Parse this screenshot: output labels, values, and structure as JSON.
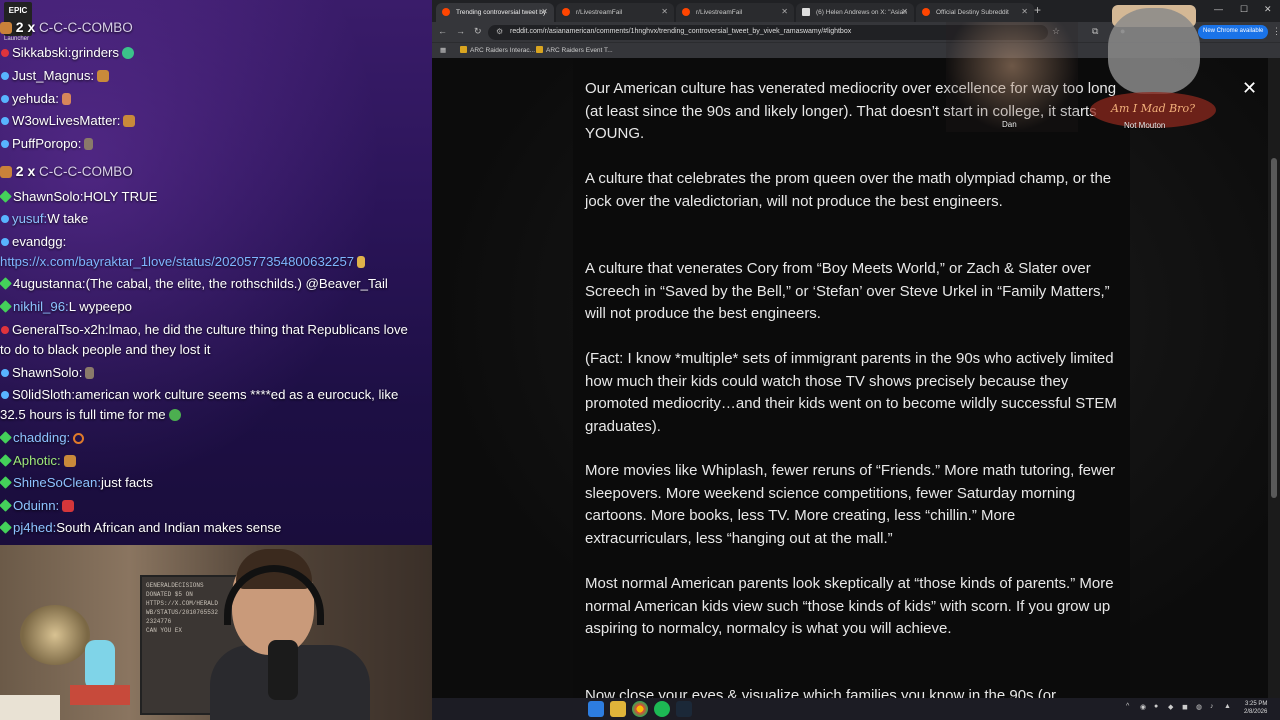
{
  "chat": {
    "launcher_logo": "EPIC",
    "launcher_label": "Launcher",
    "combo_1": {
      "count": "2 x",
      "text": "C-C-C-COMBO"
    },
    "messages_top": [
      {
        "user": "Sikkabski:",
        "text": "grinders"
      },
      {
        "user": "Just_Magnus:",
        "text": ""
      },
      {
        "user": "yehuda:",
        "text": ""
      },
      {
        "user": "W3owLivesMatter:",
        "text": ""
      },
      {
        "user": "PuffPoropo:",
        "text": ""
      }
    ],
    "combo_2": {
      "count": "2 x",
      "text": "C-C-C-COMBO"
    },
    "messages": [
      {
        "user": "ShawnSolo:",
        "text": "HOLY TRUE"
      },
      {
        "user": "yusuf:",
        "text": "W take"
      },
      {
        "user": "evandgg:",
        "text": ""
      },
      {
        "link": "https://x.com/bayraktar_1love/status/2020577354800632257"
      },
      {
        "user": "4ugustanna:",
        "text": "(The cabal, the elite, the rothschilds.) @Beaver_Tail"
      },
      {
        "user": "nikhil_96:",
        "text": "L wypeepo"
      },
      {
        "user": "GeneralTso-x2h:",
        "text": "lmao, he did the culture thing that Republicans love to do to black people and they lost it"
      },
      {
        "user": "ShawnSolo:",
        "text": ""
      },
      {
        "user": "S0lidSloth:",
        "text": "american work culture seems ****ed as a eurocuck, like 32.5 hours is full time for me"
      },
      {
        "user": "chadding:",
        "text": ""
      },
      {
        "user": "Aphotic:",
        "text": ""
      },
      {
        "user": "ShineSoClean:",
        "text": "just facts"
      },
      {
        "user": "Oduinn:",
        "text": ""
      },
      {
        "user": "pj4hed:",
        "text": "South African and Indian makes sense"
      }
    ]
  },
  "webcam": {
    "frame_text": "GENERALDECISIONS\nDONATED $5 ON\nHTTPS://X.COM/HERALD\nWB/STATUS/2010765532\n2324776\nCAN YOU EX"
  },
  "browser": {
    "tabs": [
      {
        "label": "Trending controversial tweet by"
      },
      {
        "label": "r/LivestreamFail"
      },
      {
        "label": "r/LivestreamFail"
      },
      {
        "label": "(6) Helen Andrews on X: \"Asian"
      },
      {
        "label": "Official Destiny Subreddit"
      }
    ],
    "new_tab": "+",
    "url": "reddit.com/r/asianamerican/comments/1hnghvx/trending_controversial_tweet_by_vivek_ramaswamy/#lightbox",
    "update_button": "New Chrome available",
    "bookmarks": [
      {
        "label": "ARC Raiders Interac..."
      },
      {
        "label": "ARC Raiders Event T..."
      }
    ],
    "close": "✕"
  },
  "post": {
    "paragraphs": [
      "Our American culture has venerated mediocrity over excellence for way too long (at least since the 90s and likely longer). That doesn’t start in college, it starts YOUNG.",
      "A culture that celebrates the prom queen over the math olympiad champ, or the jock over the valedictorian, will not produce the best engineers.",
      "A culture that venerates Cory from “Boy Meets World,” or Zach & Slater over Screech in “Saved by the Bell,” or ‘Stefan’ over Steve Urkel in “Family Matters,” will not produce the best engineers.",
      "(Fact: I know *multiple* sets of immigrant parents in the 90s who actively limited how much their kids could watch those TV shows precisely because they promoted mediocrity…and their kids went on to become wildly successful STEM graduates).",
      "More movies like Whiplash, fewer reruns of “Friends.” More math tutoring, fewer sleepovers. More weekend science competitions, fewer Saturday morning cartoons. More books, less TV. More creating, less “chillin.” More extracurriculars, less “hanging out at the mall.”",
      "Most normal American parents look skeptically at “those kinds of parents.” More normal American kids view such “those kinds of kids” with scorn. If you grow up aspiring to normalcy, normalcy is what you will achieve.",
      "Now close your eyes & visualize which families you know in the 90s (or"
    ]
  },
  "overlays": {
    "dan_label": "Dan",
    "cat_label": "Not Mouton",
    "sign_text": "Am I Mad Bro?"
  },
  "taskbar": {
    "time": "3:25 PM",
    "date": "2/8/2026"
  }
}
